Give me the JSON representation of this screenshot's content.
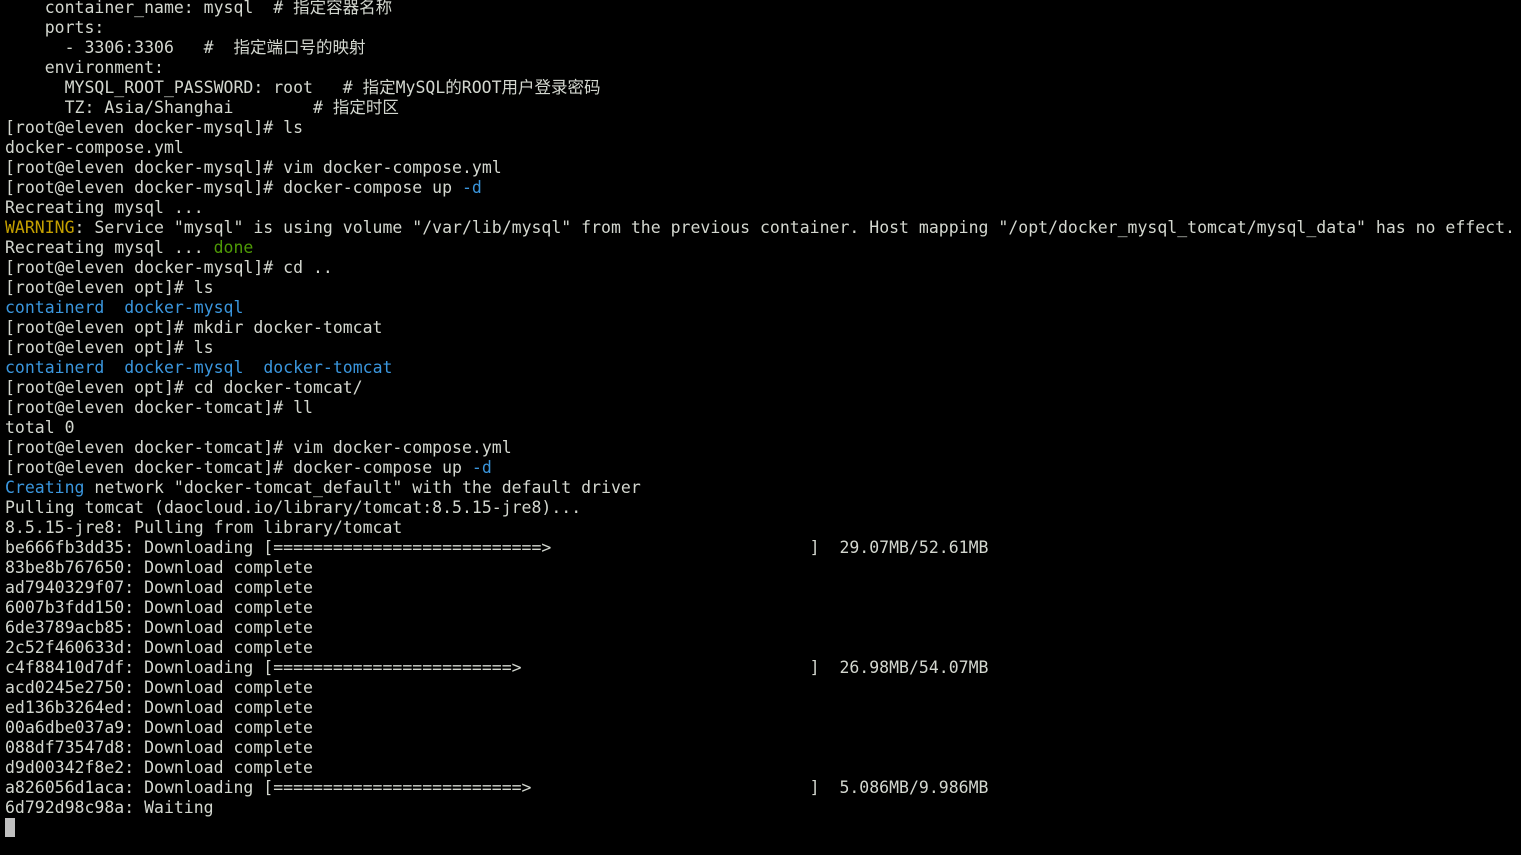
{
  "terminal": {
    "colors": {
      "background": "#000000",
      "foreground": "#d3d7cf",
      "cyan": "#3a96dd",
      "yellow": "#c4a000",
      "green": "#4e9a06",
      "cursor": "#c0c0c0"
    },
    "lines": [
      {
        "segs": [
          {
            "t": "    container_name: mysql  # 指定容器名称"
          }
        ]
      },
      {
        "segs": [
          {
            "t": "    ports:"
          }
        ]
      },
      {
        "segs": [
          {
            "t": "      - 3306:3306   #  指定端口号的映射"
          }
        ]
      },
      {
        "segs": [
          {
            "t": "    environment:"
          }
        ]
      },
      {
        "segs": [
          {
            "t": "      MYSQL_ROOT_PASSWORD: root   # 指定MySQL的ROOT用户登录密码"
          }
        ]
      },
      {
        "segs": [
          {
            "t": "      TZ: Asia/Shanghai        # 指定时区"
          }
        ]
      },
      {
        "segs": [
          {
            "t": "[root@eleven docker-mysql]# ls"
          }
        ]
      },
      {
        "segs": [
          {
            "t": "docker-compose.yml"
          }
        ]
      },
      {
        "segs": [
          {
            "t": "[root@eleven docker-mysql]# vim docker-compose.yml"
          }
        ]
      },
      {
        "segs": [
          {
            "t": "[root@eleven docker-mysql]# docker-compose up "
          },
          {
            "t": "-d",
            "c": "cyan"
          }
        ]
      },
      {
        "segs": [
          {
            "t": "Recreating mysql ..."
          }
        ]
      },
      {
        "segs": [
          {
            "t": "WARNING",
            "c": "yellow"
          },
          {
            "t": ": Service \"mysql\" is using volume \"/var/lib/mysql\" from the previous container. Host mapping \"/opt/docker_mysql_tomcat/mysql_data\" has no effect."
          }
        ]
      },
      {
        "segs": [
          {
            "t": "Recreating mysql ... "
          },
          {
            "t": "done",
            "c": "green"
          }
        ]
      },
      {
        "segs": [
          {
            "t": "[root@eleven docker-mysql]# cd .."
          }
        ]
      },
      {
        "segs": [
          {
            "t": "[root@eleven opt]# ls"
          }
        ]
      },
      {
        "segs": [
          {
            "t": "containerd",
            "c": "cyan"
          },
          {
            "t": "  "
          },
          {
            "t": "docker-mysql",
            "c": "cyan"
          }
        ]
      },
      {
        "segs": [
          {
            "t": "[root@eleven opt]# mkdir docker-tomcat"
          }
        ]
      },
      {
        "segs": [
          {
            "t": "[root@eleven opt]# ls"
          }
        ]
      },
      {
        "segs": [
          {
            "t": "containerd",
            "c": "cyan"
          },
          {
            "t": "  "
          },
          {
            "t": "docker-mysql",
            "c": "cyan"
          },
          {
            "t": "  "
          },
          {
            "t": "docker-tomcat",
            "c": "cyan"
          }
        ]
      },
      {
        "segs": [
          {
            "t": "[root@eleven opt]# cd docker-tomcat/"
          }
        ]
      },
      {
        "segs": [
          {
            "t": "[root@eleven docker-tomcat]# ll"
          }
        ]
      },
      {
        "segs": [
          {
            "t": "total 0"
          }
        ]
      },
      {
        "segs": [
          {
            "t": "[root@eleven docker-tomcat]# vim docker-compose.yml"
          }
        ]
      },
      {
        "segs": [
          {
            "t": "[root@eleven docker-tomcat]# docker-compose up "
          },
          {
            "t": "-d",
            "c": "cyan"
          }
        ]
      },
      {
        "segs": [
          {
            "t": "Creating",
            "c": "cyan"
          },
          {
            "t": " network \"docker-tomcat_default\" with the default driver"
          }
        ]
      },
      {
        "segs": [
          {
            "t": "Pulling tomcat (daocloud.io/library/tomcat:8.5.15-jre8)..."
          }
        ]
      },
      {
        "segs": [
          {
            "t": "8.5.15-jre8: Pulling from library/tomcat"
          }
        ]
      },
      {
        "segs": [
          {
            "t": "be666fb3dd35: Downloading [===========================>                          ]  29.07MB/52.61MB"
          }
        ]
      },
      {
        "segs": [
          {
            "t": "83be8b767650: Download complete"
          }
        ]
      },
      {
        "segs": [
          {
            "t": "ad7940329f07: Download complete"
          }
        ]
      },
      {
        "segs": [
          {
            "t": "6007b3fdd150: Download complete"
          }
        ]
      },
      {
        "segs": [
          {
            "t": "6de3789acb85: Download complete"
          }
        ]
      },
      {
        "segs": [
          {
            "t": "2c52f460633d: Download complete"
          }
        ]
      },
      {
        "segs": [
          {
            "t": "c4f88410d7df: Downloading [========================>                             ]  26.98MB/54.07MB"
          }
        ]
      },
      {
        "segs": [
          {
            "t": "acd0245e2750: Download complete"
          }
        ]
      },
      {
        "segs": [
          {
            "t": "ed136b3264ed: Download complete"
          }
        ]
      },
      {
        "segs": [
          {
            "t": "00a6dbe037a9: Download complete"
          }
        ]
      },
      {
        "segs": [
          {
            "t": "088df73547d8: Download complete"
          }
        ]
      },
      {
        "segs": [
          {
            "t": "d9d00342f8e2: Download complete"
          }
        ]
      },
      {
        "segs": [
          {
            "t": "a826056d1aca: Downloading [=========================>                            ]  5.086MB/9.986MB"
          }
        ]
      },
      {
        "segs": [
          {
            "t": "6d792d98c98a: Waiting"
          }
        ]
      }
    ]
  }
}
